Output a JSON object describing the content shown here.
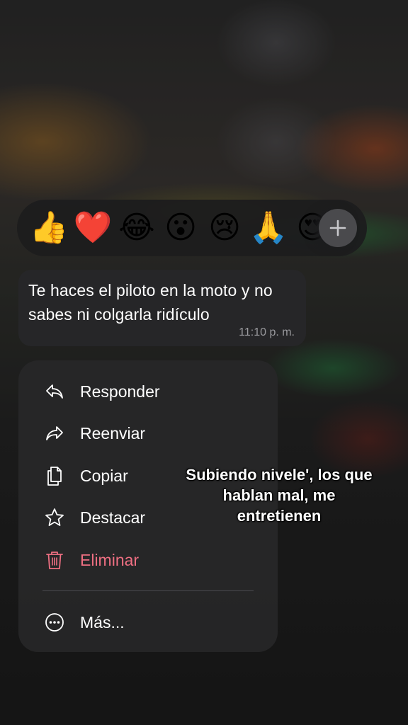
{
  "reactions": {
    "emojis": [
      {
        "name": "thumbs-up",
        "glyph": "👍"
      },
      {
        "name": "red-heart",
        "glyph": "❤️"
      },
      {
        "name": "tears-of-joy",
        "glyph": "😂"
      },
      {
        "name": "surprised",
        "glyph": "😮"
      },
      {
        "name": "crying",
        "glyph": "😢"
      },
      {
        "name": "praying-hands",
        "glyph": "🙏"
      },
      {
        "name": "heart-eyes",
        "glyph": "😍"
      }
    ],
    "add_icon": "plus-icon"
  },
  "message": {
    "text": "Te haces el piloto en la moto y no sabes ni colgarla ridículo",
    "time": "11:10 p. m."
  },
  "menu": {
    "items": [
      {
        "label": "Responder",
        "icon": "reply-icon"
      },
      {
        "label": "Reenviar",
        "icon": "forward-icon"
      },
      {
        "label": "Copiar",
        "icon": "copy-icon"
      },
      {
        "label": "Destacar",
        "icon": "star-icon"
      },
      {
        "label": "Eliminar",
        "icon": "trash-icon",
        "destructive": true
      },
      {
        "label": "Más...",
        "icon": "more-icon"
      }
    ]
  },
  "caption": {
    "text": "Subiendo nivele', los que hablan mal, me entretienen"
  },
  "colors": {
    "destructive": "#ee6f82",
    "menu_bg": "#262628",
    "text": "#ffffff",
    "timestamp": "#9a9a9e"
  }
}
